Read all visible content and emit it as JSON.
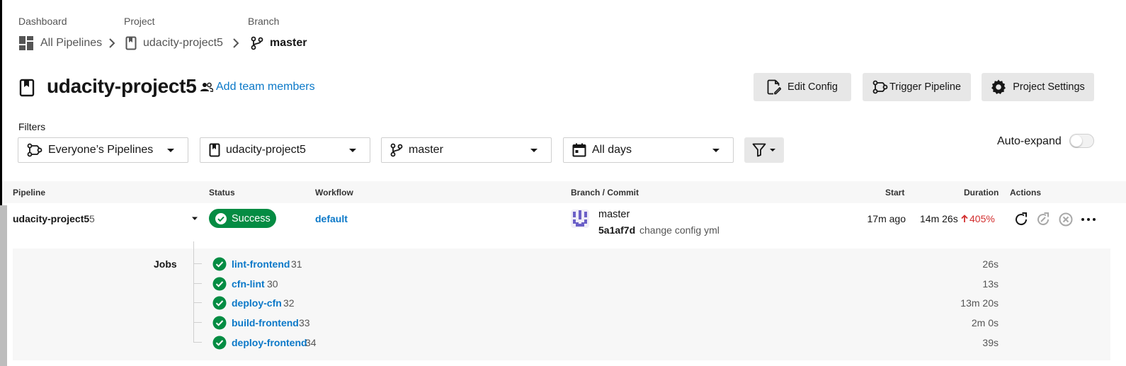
{
  "breadcrumb": {
    "dashboard_label": "Dashboard",
    "dashboard_value": "All Pipelines",
    "project_label": "Project",
    "project_value": "udacity-project5",
    "branch_label": "Branch",
    "branch_value": "master"
  },
  "header": {
    "title": "udacity-project5",
    "add_team": "Add team members",
    "edit_config": "Edit Config",
    "trigger_pipeline": "Trigger Pipeline",
    "project_settings": "Project Settings"
  },
  "filters": {
    "label": "Filters",
    "pipelines": "Everyone’s Pipelines",
    "project": "udacity-project5",
    "branch": "master",
    "days": "All days",
    "auto_expand": "Auto-expand",
    "auto_expand_on": false
  },
  "table": {
    "headers": {
      "pipeline": "Pipeline",
      "status": "Status",
      "workflow": "Workflow",
      "branch_commit": "Branch / Commit",
      "start": "Start",
      "duration": "Duration",
      "actions": "Actions"
    },
    "row": {
      "pipeline": "udacity-project5",
      "number": "5",
      "status": "Success",
      "workflow": "default",
      "branch": "master",
      "commit_hash": "5a1af7d",
      "commit_msg": "change config yml",
      "start": "17m ago",
      "duration": "14m 26s",
      "delta": "405%"
    }
  },
  "jobs": {
    "label": "Jobs",
    "items": [
      {
        "name": "lint-frontend",
        "number": "31",
        "duration": "26s"
      },
      {
        "name": "cfn-lint",
        "number": "30",
        "duration": "13s"
      },
      {
        "name": "deploy-cfn",
        "number": "32",
        "duration": "13m 20s"
      },
      {
        "name": "build-frontend",
        "number": "33",
        "duration": "2m 0s"
      },
      {
        "name": "deploy-frontend",
        "number": "34",
        "duration": "39s"
      }
    ]
  },
  "colors": {
    "link": "#0a78c8",
    "success": "#048c43",
    "delta_up": "#d32f2f",
    "button_bg": "#e7e7e7"
  }
}
